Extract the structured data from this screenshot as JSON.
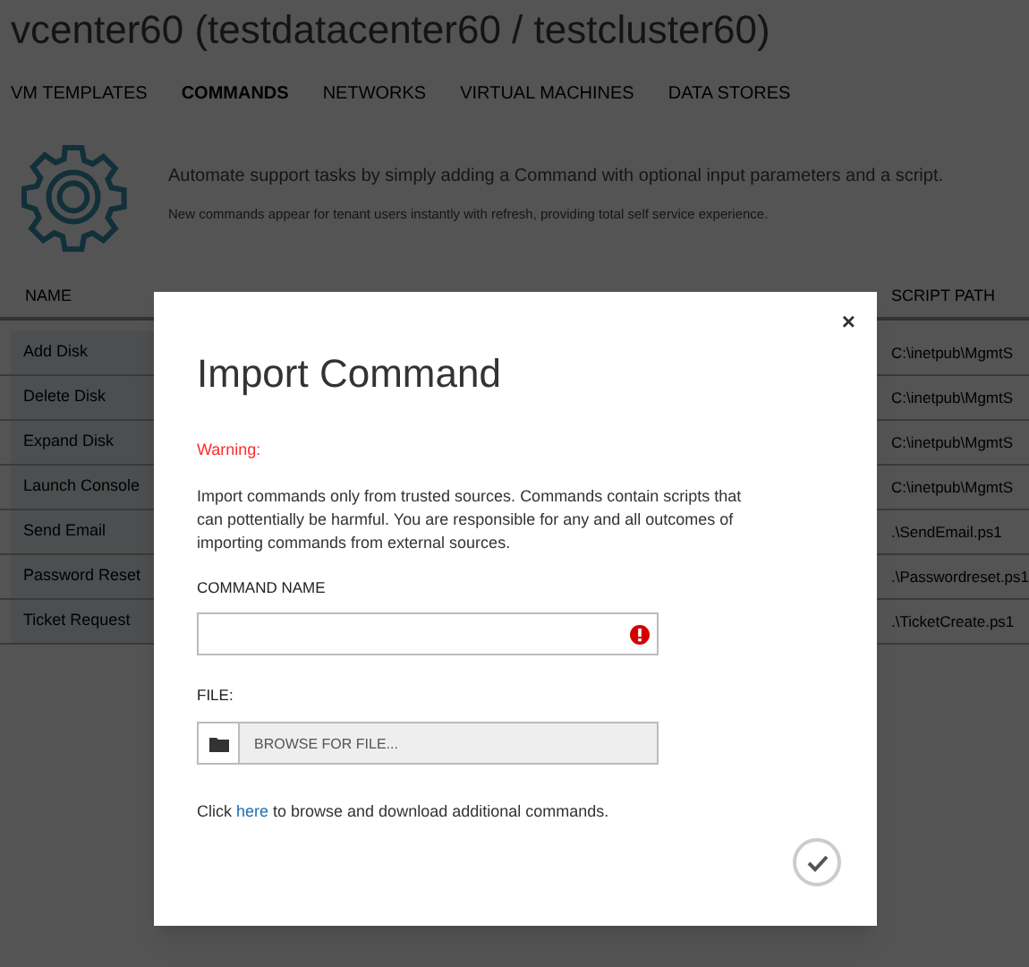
{
  "page_title": "vcenter60 (testdatacenter60 / testcluster60)",
  "tabs": [
    {
      "label": "VM TEMPLATES",
      "selected": false
    },
    {
      "label": "COMMANDS",
      "selected": true
    },
    {
      "label": "NETWORKS",
      "selected": false
    },
    {
      "label": "VIRTUAL MACHINES",
      "selected": false
    },
    {
      "label": "DATA STORES",
      "selected": false
    }
  ],
  "intro": {
    "headline": "Automate support tasks by simply adding a Command with optional input parameters and a script.",
    "subline": "New commands appear for tenant users instantly with refresh, providing total self service experience."
  },
  "table": {
    "columns": [
      "NAME",
      "SCRIPT PATH"
    ],
    "rows": [
      {
        "name": "Add Disk",
        "script_path": "C:\\inetpub\\MgmtS"
      },
      {
        "name": "Delete Disk",
        "script_path": "C:\\inetpub\\MgmtS"
      },
      {
        "name": "Expand Disk",
        "script_path": "C:\\inetpub\\MgmtS"
      },
      {
        "name": "Launch Console",
        "script_path": "C:\\inetpub\\MgmtS"
      },
      {
        "name": "Send Email",
        "script_path": ".\\SendEmail.ps1"
      },
      {
        "name": "Password Reset",
        "script_path": ".\\Passwordreset.ps1"
      },
      {
        "name": "Ticket Request",
        "script_path": ".\\TicketCreate.ps1"
      }
    ]
  },
  "dialog": {
    "close": "×",
    "title": "Import Command",
    "warning_label": "Warning:",
    "warning_text": "Import commands only from trusted sources. Commands contain scripts that can pottentially be harmful. You are responsible for any and all outcomes of importing commands from external sources.",
    "command_name": {
      "label": "COMMAND NAME",
      "invalid": true
    },
    "file": {
      "label": "FILE:",
      "placeholder": "BROWSE FOR FILE..."
    },
    "footer": {
      "prefix": "Click ",
      "link": "here",
      "suffix": " to browse and download additional commands."
    }
  }
}
